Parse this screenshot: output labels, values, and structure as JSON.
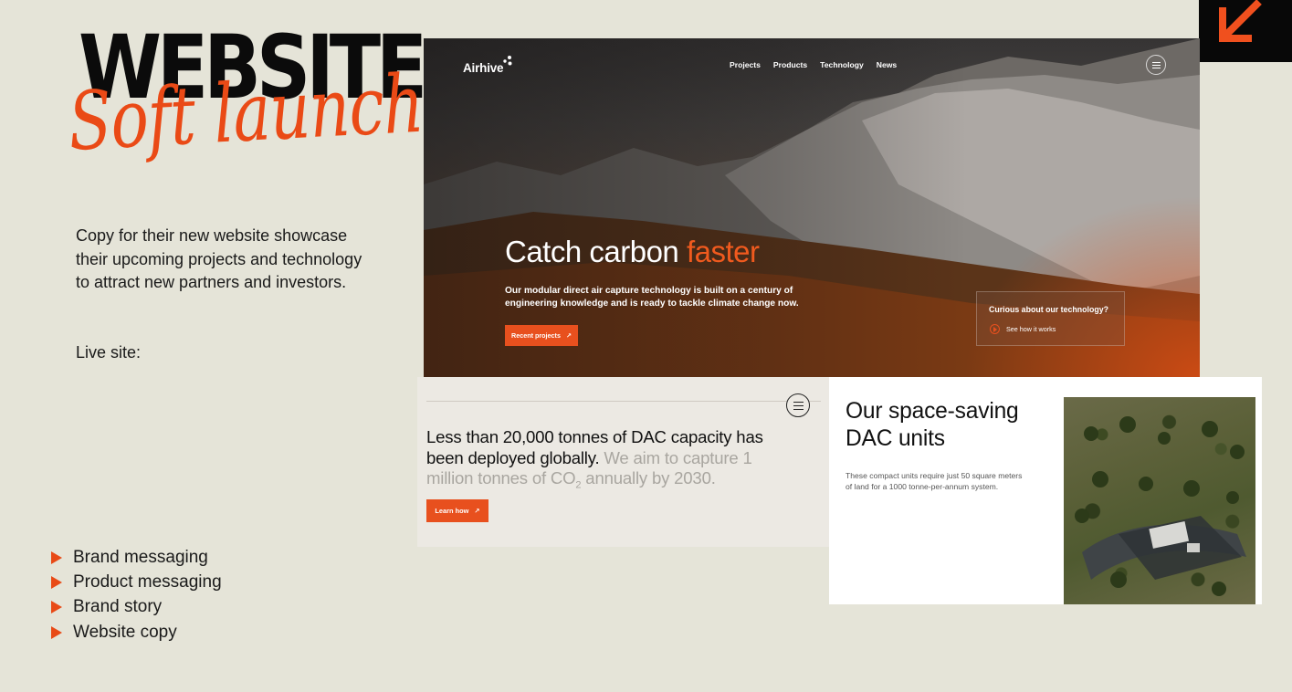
{
  "left": {
    "title": "WEBSITE",
    "script_title": "Soft launch",
    "intro": "Copy for their new website showcase their upcoming projects and technology to attract new partners and investors.",
    "live_site_label": "Live site:",
    "bullets": [
      "Brand messaging",
      "Product messaging",
      "Brand story",
      "Website copy"
    ]
  },
  "hero": {
    "brand": "Airhive",
    "nav": [
      "Projects",
      "Products",
      "Technology",
      "News"
    ],
    "headline_main": "Catch carbon ",
    "headline_accent": "faster",
    "subtext": "Our modular direct air capture technology is built on a century of engineering knowledge and is ready to tackle climate change now.",
    "cta": "Recent projects",
    "cta_arrow": "↗",
    "curious_title": "Curious about our technology?",
    "curious_link": "See how it works"
  },
  "stats": {
    "text_dark": "Less than 20,000 tonnes of DAC capacity has been deployed globally.",
    "text_muted_before": " We aim to capture 1 million tonnes of CO",
    "text_sub": "2",
    "text_muted_after": " annually by 2030.",
    "cta": "Learn how",
    "cta_arrow": "↗"
  },
  "units": {
    "heading": "Our space-saving DAC units",
    "body": "These compact units require just 50 square meters of land for a 1000 tonne-per-annum system."
  },
  "colors": {
    "accent": "#e8501e",
    "background": "#e5e4d8",
    "corner_logo_bg": "#080808"
  },
  "icons": {
    "corner_logo": "arrow-down-left-icon",
    "menu": "hamburger-menu-icon",
    "play": "play-circle-icon",
    "bullet": "triangle-right-icon"
  }
}
